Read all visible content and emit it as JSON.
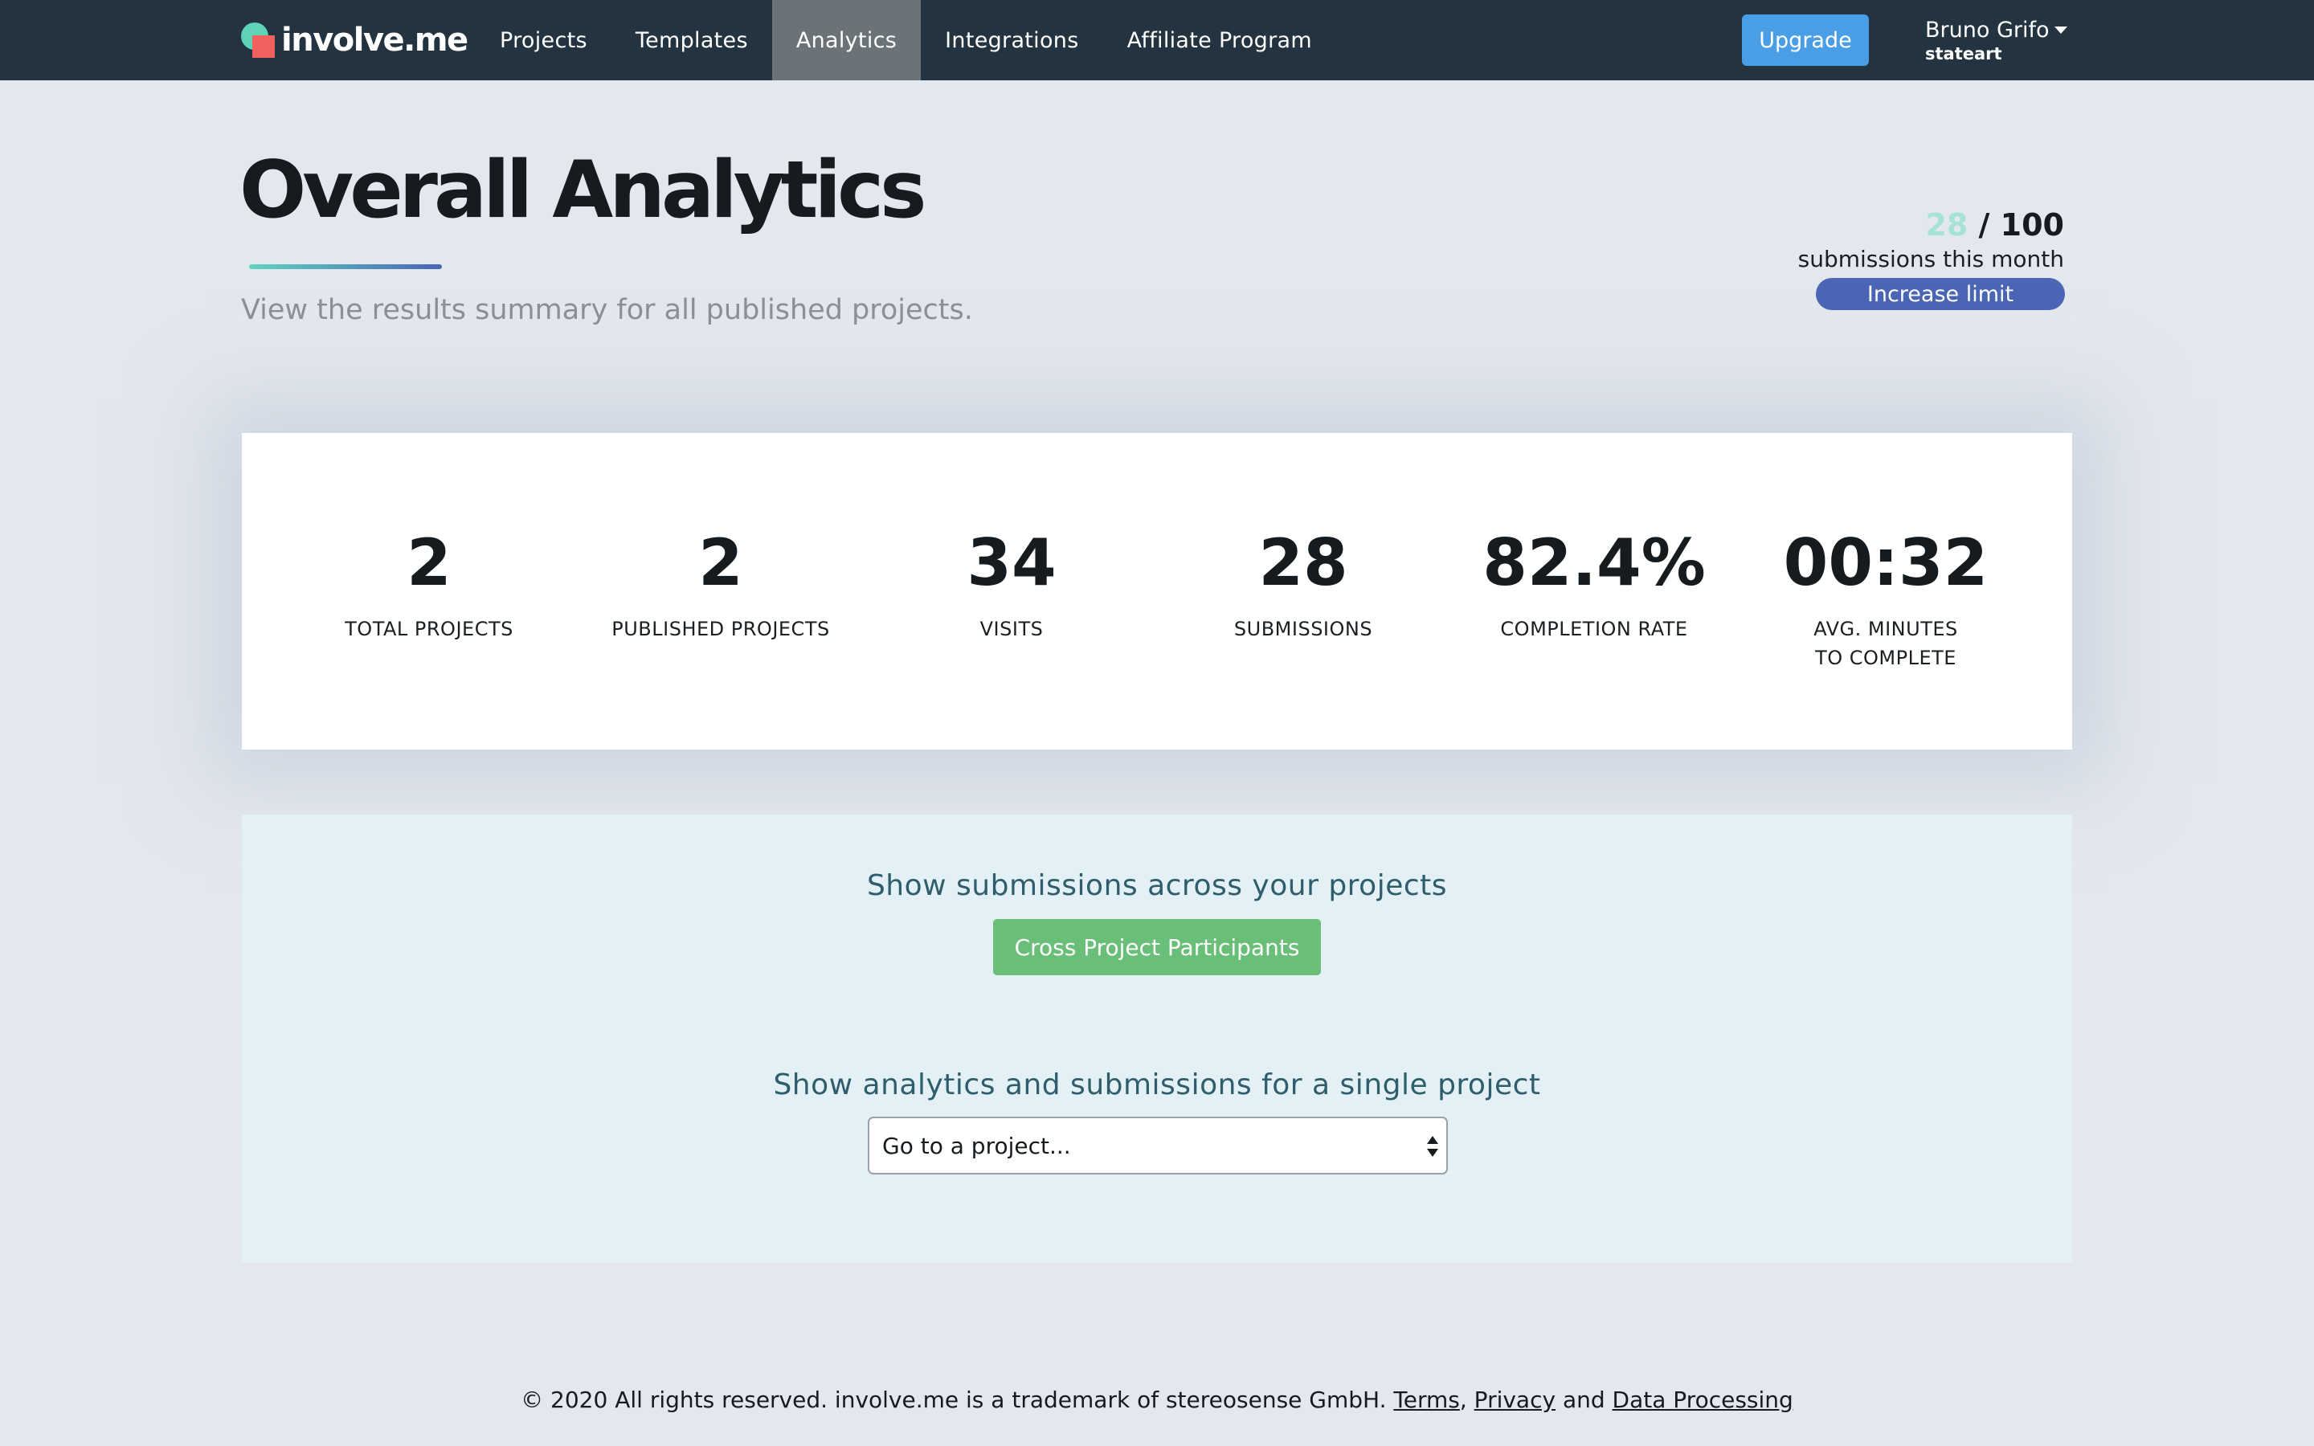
{
  "navbar": {
    "logo_text": "involve.me",
    "items": [
      {
        "label": "Projects",
        "active": false
      },
      {
        "label": "Templates",
        "active": false
      },
      {
        "label": "Analytics",
        "active": true
      },
      {
        "label": "Integrations",
        "active": false
      },
      {
        "label": "Affiliate Program",
        "active": false
      }
    ],
    "upgrade_label": "Upgrade",
    "user": {
      "name": "Bruno Grifo",
      "org": "stateart"
    }
  },
  "header": {
    "title": "Overall Analytics",
    "subtitle": "View the results summary for all published projects."
  },
  "quota": {
    "used": "28",
    "separator": " / ",
    "limit": "100",
    "label": "submissions this month",
    "increase_label": "Increase limit"
  },
  "stats": [
    {
      "value": "2",
      "label": "TOTAL PROJECTS"
    },
    {
      "value": "2",
      "label": "PUBLISHED PROJECTS"
    },
    {
      "value": "34",
      "label": "VISITS"
    },
    {
      "value": "28",
      "label": "SUBMISSIONS"
    },
    {
      "value": "82.4%",
      "label": "COMPLETION RATE"
    },
    {
      "value": "00:32",
      "label": "AVG. MINUTES TO COMPLETE"
    }
  ],
  "actions": {
    "cross_heading": "Show submissions across your projects",
    "cross_button": "Cross Project Participants",
    "single_heading": "Show analytics and submissions for a single project",
    "select_value": "Go to a project..."
  },
  "footer": {
    "text": "© 2020 All rights reserved. involve.me is a trademark of stereosense GmbH. ",
    "terms": "Terms",
    "comma": ", ",
    "privacy": "Privacy",
    "and": " and ",
    "data_processing": "Data Processing"
  },
  "colors": {
    "navbar_bg": "#23333f",
    "active_tab_bg": "#6b7378",
    "upgrade_blue": "#4a9ee6",
    "increase_blue": "#4a66b5",
    "quota_used_teal": "#a6e3d6",
    "cross_button_green": "#6abf78",
    "panel_bg": "#e3f1f6",
    "page_bg": "#e3e7ee"
  }
}
